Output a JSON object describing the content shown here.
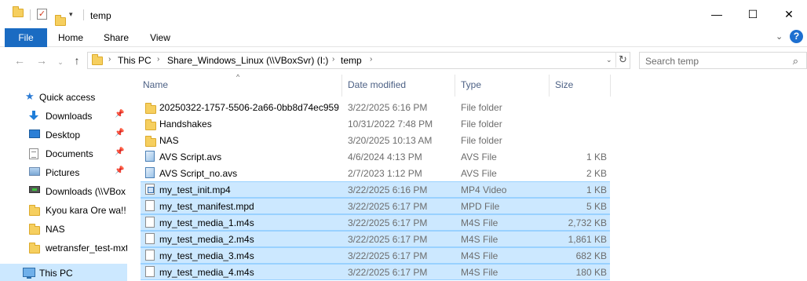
{
  "window": {
    "title": "temp",
    "minimize": "—",
    "maximize": "☐",
    "close": "✕"
  },
  "quick_access_toolbar": {
    "dropdown": "▾"
  },
  "ribbon": {
    "tabs": [
      "File",
      "Home",
      "Share",
      "View"
    ],
    "expand": "⌄",
    "help": "?"
  },
  "nav": {
    "back": "←",
    "forward": "→",
    "recent": "⌄",
    "up": "↑"
  },
  "address": {
    "crumbs": [
      "This PC",
      "Share_Windows_Linux (\\\\VBoxSvr) (I:)",
      "temp"
    ],
    "separator": "›",
    "dropdown": "⌄",
    "refresh": "↻"
  },
  "search": {
    "placeholder": "Search temp",
    "icon": "⌕"
  },
  "sidebar": {
    "pin": "📌",
    "items": [
      {
        "label": "Quick access",
        "icon": "star-icon"
      },
      {
        "label": "Downloads",
        "icon": "download-icon",
        "pinned": true
      },
      {
        "label": "Desktop",
        "icon": "desktop-icon",
        "pinned": true
      },
      {
        "label": "Documents",
        "icon": "documents-icon",
        "pinned": true
      },
      {
        "label": "Pictures",
        "icon": "pictures-icon",
        "pinned": true
      },
      {
        "label": "Downloads (\\\\VBox",
        "icon": "network-drive-icon"
      },
      {
        "label": "Kyou kara Ore wa!! E",
        "icon": "folder-icon"
      },
      {
        "label": "NAS",
        "icon": "folder-icon"
      },
      {
        "label": "wetransfer_test-mxt",
        "icon": "folder-icon"
      },
      {
        "label": "This PC",
        "icon": "this-pc-icon",
        "selected": true
      }
    ]
  },
  "columns": {
    "name": "Name",
    "date": "Date modified",
    "type": "Type",
    "size": "Size",
    "sort_indicator": "^"
  },
  "files": [
    {
      "name": "20250322-1757-5506-2a66-0bb8d74ec959",
      "date": "3/22/2025 6:16 PM",
      "type": "File folder",
      "size": "",
      "icon": "folder-icon",
      "selected": false
    },
    {
      "name": "Handshakes",
      "date": "10/31/2022 7:48 PM",
      "type": "File folder",
      "size": "",
      "icon": "folder-icon",
      "selected": false
    },
    {
      "name": "NAS",
      "date": "3/20/2025 10:13 AM",
      "type": "File folder",
      "size": "",
      "icon": "folder-icon",
      "selected": false
    },
    {
      "name": "AVS Script.avs",
      "date": "4/6/2024 4:13 PM",
      "type": "AVS File",
      "size": "1 KB",
      "icon": "avs-file-icon",
      "selected": false
    },
    {
      "name": "AVS Script_no.avs",
      "date": "2/7/2023 1:12 PM",
      "type": "AVS File",
      "size": "2 KB",
      "icon": "avs-file-icon",
      "selected": false
    },
    {
      "name": "my_test_init.mp4",
      "date": "3/22/2025 6:16 PM",
      "type": "MP4 Video",
      "size": "1 KB",
      "icon": "video-file-icon",
      "selected": true
    },
    {
      "name": "my_test_manifest.mpd",
      "date": "3/22/2025 6:17 PM",
      "type": "MPD File",
      "size": "5 KB",
      "icon": "file-icon",
      "selected": true
    },
    {
      "name": "my_test_media_1.m4s",
      "date": "3/22/2025 6:17 PM",
      "type": "M4S File",
      "size": "2,732 KB",
      "icon": "file-icon",
      "selected": true
    },
    {
      "name": "my_test_media_2.m4s",
      "date": "3/22/2025 6:17 PM",
      "type": "M4S File",
      "size": "1,861 KB",
      "icon": "file-icon",
      "selected": true
    },
    {
      "name": "my_test_media_3.m4s",
      "date": "3/22/2025 6:17 PM",
      "type": "M4S File",
      "size": "682 KB",
      "icon": "file-icon",
      "selected": true
    },
    {
      "name": "my_test_media_4.m4s",
      "date": "3/22/2025 6:17 PM",
      "type": "M4S File",
      "size": "180 KB",
      "icon": "file-icon",
      "selected": true
    }
  ]
}
